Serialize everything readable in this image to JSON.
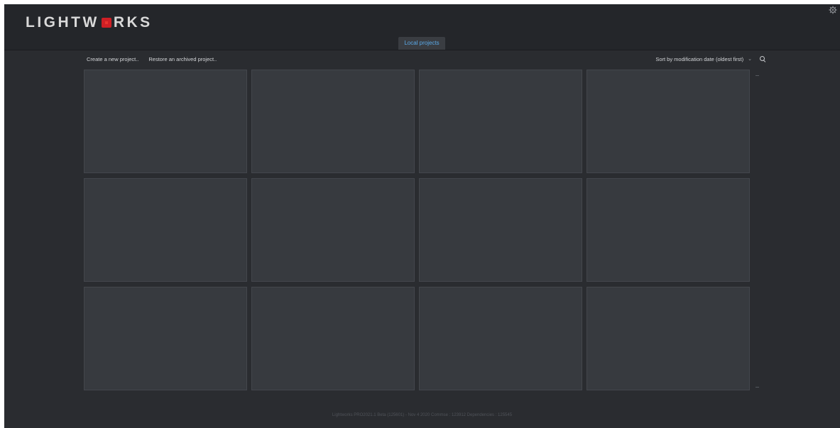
{
  "app": {
    "logo_text_before": "LIGHTW",
    "logo_text_after": "RKS",
    "logo_accent_color": "#cf1f25"
  },
  "header": {
    "settings_icon": "gear-icon",
    "tabs": [
      {
        "label": "Local projects",
        "active": true
      }
    ]
  },
  "toolbar": {
    "create_label": "Create a new project..",
    "restore_label": "Restore an archived project..",
    "sort_label": "Sort by modification date (oldest first)",
    "sort_chevron": "⌄",
    "search_icon": "search-icon"
  },
  "projects": {
    "tile_count": 12
  },
  "footer": {
    "version_text": "Lightworks PRO2021.1 Beta (125601) - Nov 4 2020 Commse : 123912 Dependencies : 125545"
  }
}
